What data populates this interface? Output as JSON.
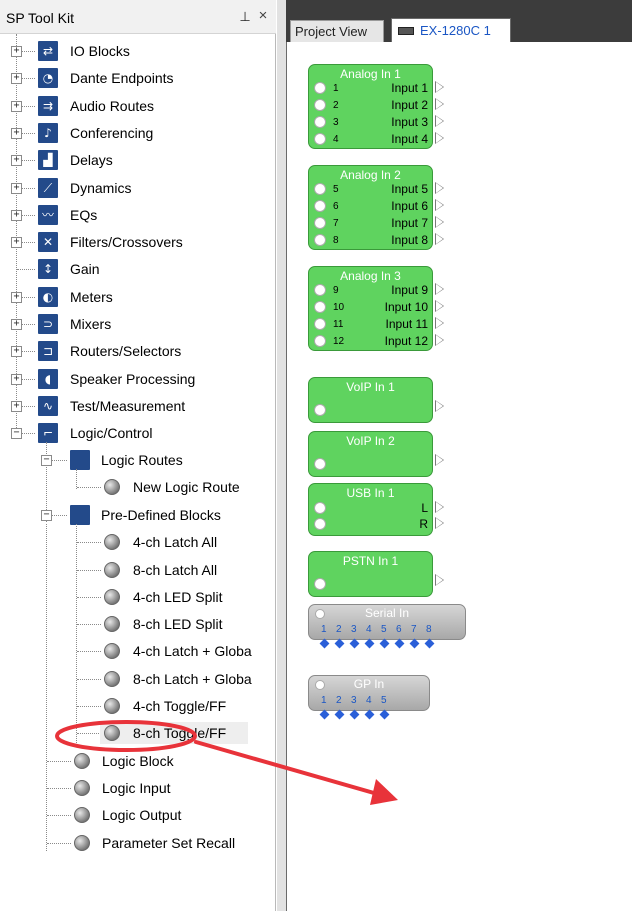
{
  "toolkit": {
    "title": "SP Tool Kit",
    "pin_glyph": "📌",
    "close_glyph": "×",
    "categories": [
      {
        "label": "IO Blocks",
        "icon": "io-blocks-icon"
      },
      {
        "label": "Dante Endpoints",
        "icon": "dante-icon"
      },
      {
        "label": "Audio Routes",
        "icon": "audio-routes-icon"
      },
      {
        "label": "Conferencing",
        "icon": "conferencing-icon"
      },
      {
        "label": "Delays",
        "icon": "delays-icon"
      },
      {
        "label": "Dynamics",
        "icon": "dynamics-icon"
      },
      {
        "label": "EQs",
        "icon": "eq-icon"
      },
      {
        "label": "Filters/Crossovers",
        "icon": "filters-icon"
      },
      {
        "label": "Gain",
        "icon": "gain-icon"
      },
      {
        "label": "Meters",
        "icon": "meters-icon"
      },
      {
        "label": "Mixers",
        "icon": "mixers-icon"
      },
      {
        "label": "Routers/Selectors",
        "icon": "routers-icon"
      },
      {
        "label": "Speaker Processing",
        "icon": "speaker-icon"
      },
      {
        "label": "Test/Measurement",
        "icon": "test-icon"
      },
      {
        "label": "Logic/Control",
        "icon": "logic-icon"
      }
    ],
    "logic_routes": {
      "label": "Logic Routes",
      "children": [
        "New Logic Route"
      ]
    },
    "predefined": {
      "label": "Pre-Defined Blocks",
      "children": [
        "4-ch Latch All",
        "8-ch Latch All",
        "4-ch LED Split",
        "8-ch LED Split",
        "4-ch Latch + Globa",
        "8-ch Latch + Globa",
        "4-ch Toggle/FF",
        "8-ch Toggle/FF"
      ]
    },
    "logic_items": [
      "Logic Block",
      "Logic Input",
      "Logic Output",
      "Parameter Set Recall"
    ]
  },
  "project": {
    "tabs": [
      "Project View",
      "EX-1280C 1"
    ],
    "analog_blocks": [
      {
        "title": "Analog In 1",
        "pins": [
          "1",
          "2",
          "3",
          "4"
        ],
        "outputs": [
          "Input 1",
          "Input 2",
          "Input 3",
          "Input 4"
        ]
      },
      {
        "title": "Analog In 2",
        "pins": [
          "5",
          "6",
          "7",
          "8"
        ],
        "outputs": [
          "Input 5",
          "Input 6",
          "Input 7",
          "Input 8"
        ]
      },
      {
        "title": "Analog In 3",
        "pins": [
          "9",
          "10",
          "11",
          "12"
        ],
        "outputs": [
          "Input 9",
          "Input 10",
          "Input 11",
          "Input 12"
        ]
      }
    ],
    "voip_blocks": [
      "VoIP In 1",
      "VoIP In 2"
    ],
    "usb_block": {
      "title": "USB In 1",
      "outputs": [
        "L",
        "R"
      ]
    },
    "pstn_block": "PSTN In 1",
    "serial_block": {
      "title": "Serial In",
      "pins": [
        "1",
        "2",
        "3",
        "4",
        "5",
        "6",
        "7",
        "8"
      ]
    },
    "gp_block": {
      "title": "GP In",
      "pins": [
        "1",
        "2",
        "3",
        "4",
        "5"
      ]
    }
  },
  "colors": {
    "block_green": "#5fd35f",
    "annotation_red": "#e8333a",
    "pin_blue": "#1a56c4"
  }
}
